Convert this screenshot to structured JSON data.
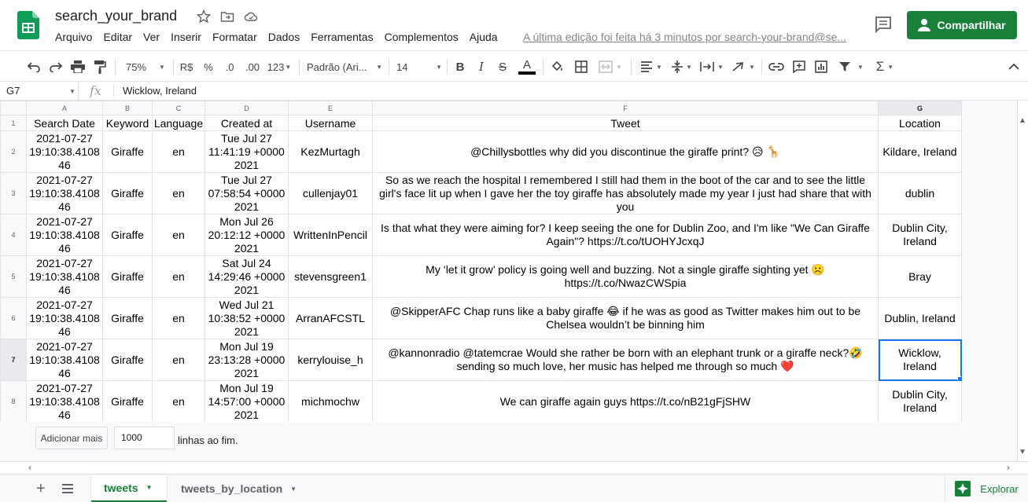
{
  "app": {
    "title": "search_your_brand",
    "last_edit": "A última edição foi feita há 3 minutos por search-your-brand@se...",
    "share_label": "Compartilhar",
    "brand_color": "#188038"
  },
  "menu": [
    "Arquivo",
    "Editar",
    "Ver",
    "Inserir",
    "Formatar",
    "Dados",
    "Ferramentas",
    "Complementos",
    "Ajuda"
  ],
  "toolbar": {
    "zoom": "75%",
    "currency": "R$",
    "percent": "%",
    "decimal_decrease": ".0",
    "decimal_increase": ".00",
    "more_formats": "123",
    "font": "Padrão (Ari...",
    "font_size": "14",
    "icons": [
      "undo-icon",
      "redo-icon",
      "print-icon",
      "paint-format-icon",
      "bold-icon",
      "italic-icon",
      "strikethrough-icon",
      "text-color-icon",
      "fill-color-icon",
      "borders-icon",
      "merge-icon",
      "align-icon",
      "valign-icon",
      "wrap-icon",
      "rotate-icon",
      "link-icon",
      "comment-icon",
      "chart-icon",
      "filter-icon",
      "functions-icon"
    ]
  },
  "formula_bar": {
    "cell_ref": "G7",
    "fx": "fx",
    "value": "Wicklow, Ireland"
  },
  "grid": {
    "columns": [
      "A",
      "B",
      "C",
      "D",
      "E",
      "F",
      "G"
    ],
    "row_numbers": [
      "1",
      "2",
      "3",
      "4",
      "5",
      "6",
      "7",
      "8"
    ],
    "headers": [
      "Search Date",
      "Keyword",
      "Language",
      "Created at",
      "Username",
      "Tweet",
      "Location"
    ],
    "rows": [
      [
        "2021-07-27 19:10:38.4108 46",
        "Giraffe",
        "en",
        "Tue Jul 27 11:41:19 +0000 2021",
        "KezMurtagh",
        "@Chillysbottles why did you discontinue the giraffe print? 😥 🦒",
        "Kildare, Ireland"
      ],
      [
        "2021-07-27 19:10:38.4108 46",
        "Giraffe",
        "en",
        "Tue Jul 27 07:58:54 +0000 2021",
        "cullenjay01",
        "So as we reach the hospital I remembered I still had them in the boot of the car and to see the little girl's face lit up when I gave her the toy giraffe has absolutely made my year I just had share that with you",
        "dublin"
      ],
      [
        "2021-07-27 19:10:38.4108 46",
        "Giraffe",
        "en",
        "Mon Jul 26 20:12:12 +0000 2021",
        "WrittenInPencil",
        "Is that what they were aiming for? I keep  seeing the one for Dublin Zoo, and I'm like \"We Can Giraffe Again\"? https://t.co/tUOHYJcxqJ",
        "Dublin City, Ireland"
      ],
      [
        "2021-07-27 19:10:38.4108 46",
        "Giraffe",
        "en",
        "Sat Jul 24 14:29:46 +0000 2021",
        "stevensgreen1",
        "My ‘let it grow’ policy is going well and buzzing. Not a single giraffe sighting yet ☹️ https://t.co/NwazCWSpia",
        "Bray"
      ],
      [
        "2021-07-27 19:10:38.4108 46",
        "Giraffe",
        "en",
        "Wed Jul 21 10:38:52 +0000 2021",
        "ArranAFCSTL",
        "@SkipperAFC Chap runs like a baby giraffe 😂 if he was as good as Twitter makes him out to be Chelsea wouldn’t be binning him",
        "Dublin, Ireland"
      ],
      [
        "2021-07-27 19:10:38.4108 46",
        "Giraffe",
        "en",
        "Mon Jul 19 23:13:28 +0000 2021",
        "kerrylouise_h",
        "@kannonradio @tatemcrae Would she rather be born with an elephant trunk or a giraffe neck?🤣 sending so much love, her music has helped me through so much ❤️",
        "Wicklow, Ireland"
      ],
      [
        "2021-07-27 19:10:38.4108 46",
        "Giraffe",
        "en",
        "Mon Jul 19 14:57:00 +0000 2021",
        "michmochw",
        "We can giraffe again guys https://t.co/nB21gFjSHW",
        "Dublin City, Ireland"
      ]
    ],
    "selected_row": 5,
    "selected_col": 6
  },
  "add_rows": {
    "button": "Adicionar mais",
    "value": "1000",
    "suffix": "linhas ao fim."
  },
  "sheets": {
    "tabs": [
      "tweets",
      "tweets_by_location"
    ],
    "active": "tweets",
    "explore": "Explorar"
  }
}
